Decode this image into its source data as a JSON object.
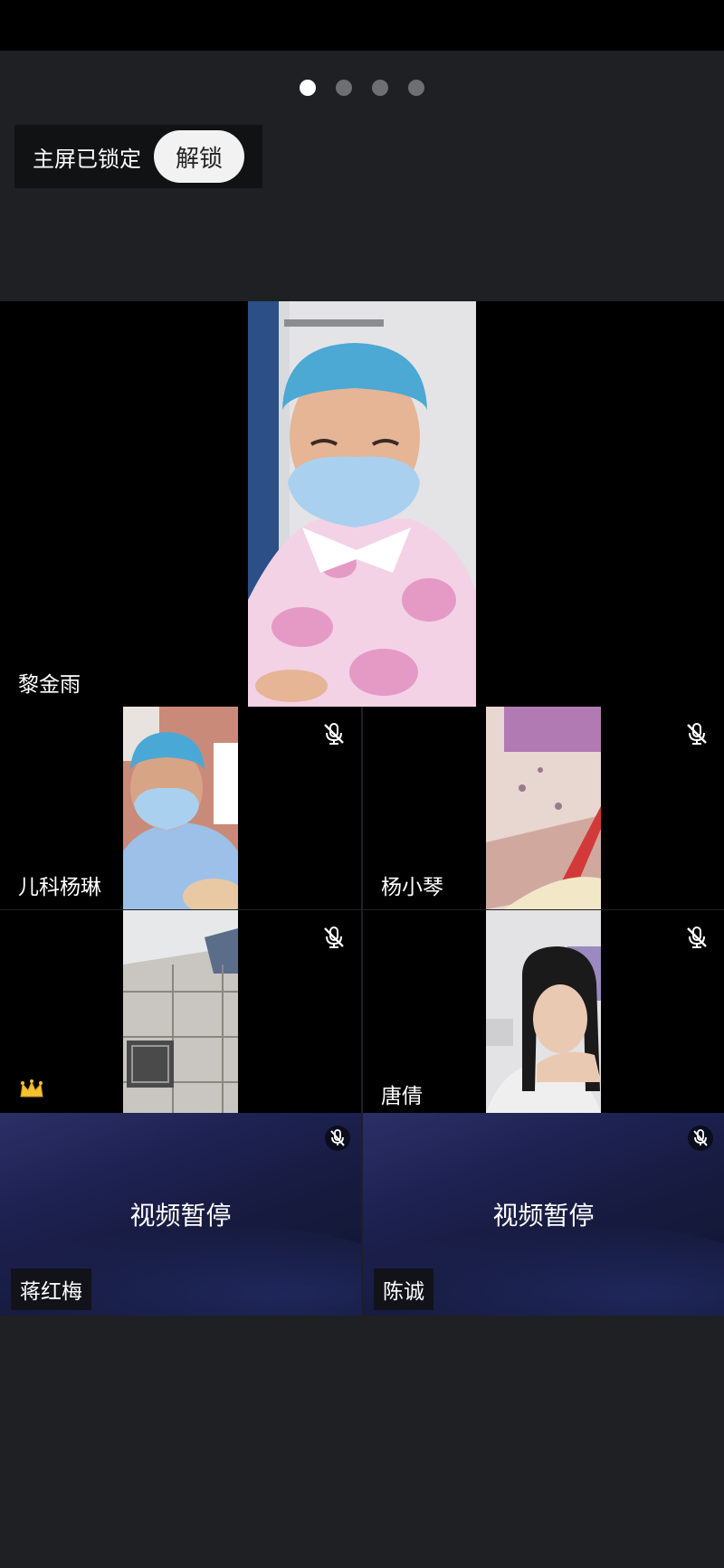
{
  "pager": {
    "count": 4,
    "active_index": 0
  },
  "lock_banner": {
    "text": "主屏已锁定",
    "button_label": "解锁"
  },
  "main_speaker": {
    "name": "黎金雨"
  },
  "grid": {
    "tiles": [
      {
        "name": "儿科杨琳",
        "muted": true
      },
      {
        "name": "杨小琴",
        "muted": true
      },
      {
        "name": "",
        "muted": true,
        "host_icon": "crown-icon"
      },
      {
        "name": "唐倩",
        "muted": true
      }
    ],
    "paused_tiles": [
      {
        "name": "蒋红梅",
        "status": "视频暂停",
        "muted": true
      },
      {
        "name": "陈诚",
        "status": "视频暂停",
        "muted": true
      }
    ]
  },
  "colors": {
    "background": "#1f2024",
    "paused_tile": "#1e2252",
    "dot_inactive": "#6e6f73"
  }
}
